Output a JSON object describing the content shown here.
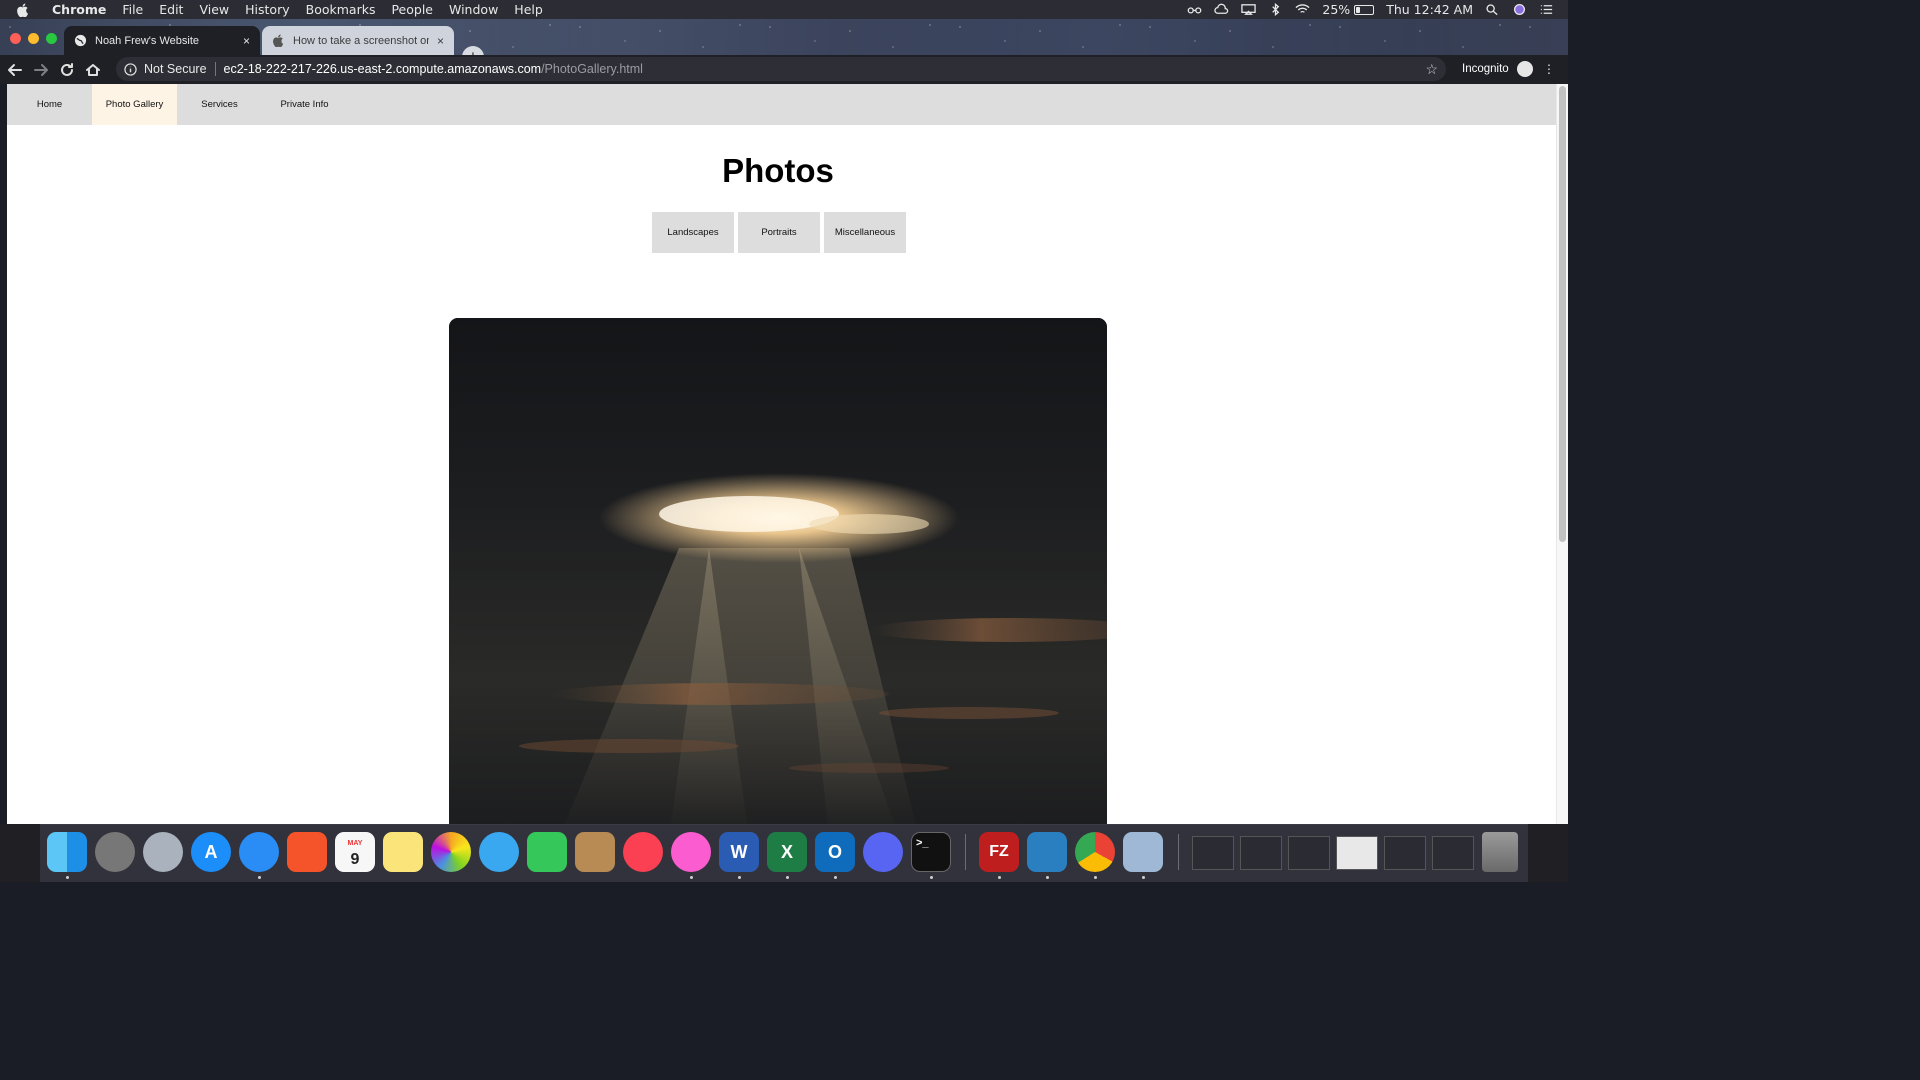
{
  "menubar": {
    "app": "Chrome",
    "items": [
      "File",
      "Edit",
      "View",
      "History",
      "Bookmarks",
      "People",
      "Window",
      "Help"
    ],
    "battery_percent": "25%",
    "battery_level": 0.25,
    "clock": "Thu 12:42 AM"
  },
  "tabs": [
    {
      "title": "Noah Frew's Website",
      "icon": "globe-icon",
      "close": "×"
    },
    {
      "title": "How to take a screenshot on y",
      "icon": "apple-icon",
      "close": "×"
    }
  ],
  "new_tab_label": "+",
  "toolbar": {
    "security": "Not Secure",
    "url_host": "ec2-18-222-217-226.us-east-2.compute.amazonaws.com",
    "url_path": "/PhotoGallery.html",
    "bookmark_star": "☆",
    "profile": "Incognito"
  },
  "site": {
    "nav": [
      "Home",
      "Photo Gallery",
      "Services",
      "Private Info"
    ],
    "active_nav": "Photo Gallery",
    "heading": "Photos",
    "filters": [
      "Landscapes",
      "Portraits",
      "Miscellaneous"
    ]
  },
  "dock": {
    "apps": [
      "finder-icon",
      "system-preferences-icon",
      "launchpad-icon",
      "app-store-icon",
      "safari-icon",
      "brave-icon",
      "calendar-icon",
      "notes-icon",
      "photos-icon",
      "messages-icon",
      "facetime-icon",
      "contacts-icon",
      "news-icon",
      "itunes-icon",
      "word-icon",
      "excel-icon",
      "outlook-icon",
      "discord-icon",
      "terminal-icon",
      "filezilla-icon",
      "frame-icon",
      "chrome-icon",
      "preview-icon"
    ],
    "calendar_month": "MAY",
    "calendar_day": "9",
    "word_letter": "W",
    "excel_letter": "X",
    "outlook_letter": "O",
    "filezilla_letter": "FZ",
    "terminal_prompt": ">_"
  }
}
